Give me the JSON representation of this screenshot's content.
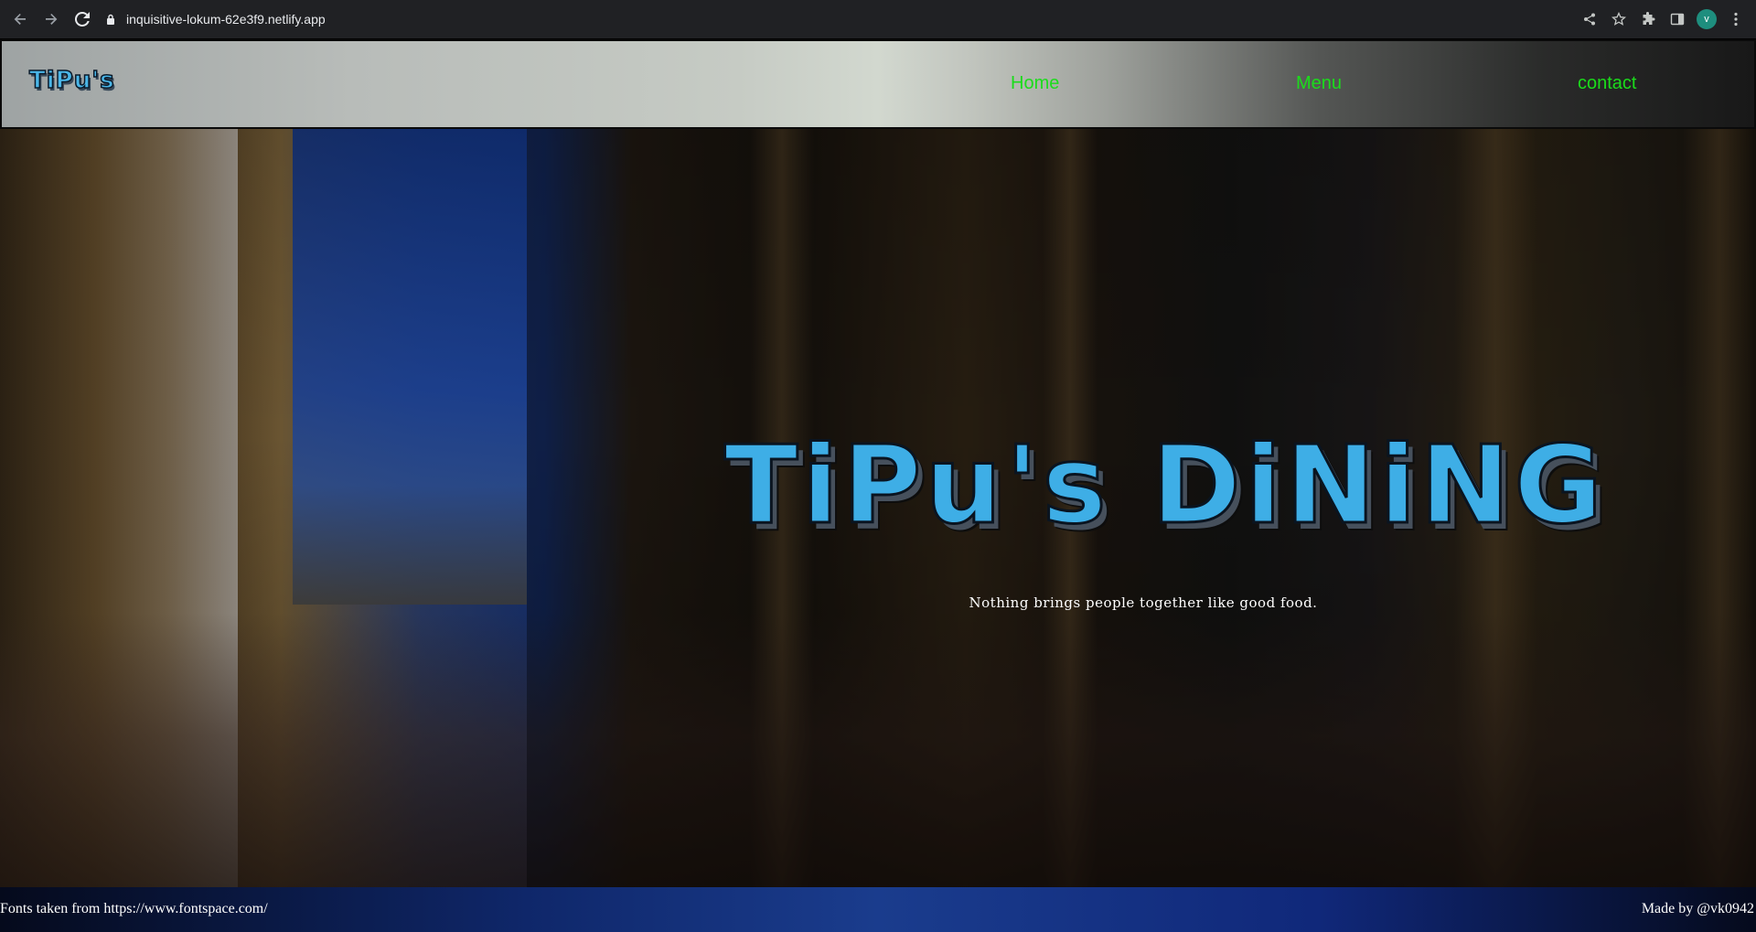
{
  "browser": {
    "url": "inquisitive-lokum-62e3f9.netlify.app",
    "profile_initial": "v",
    "icons": [
      "back-icon",
      "forward-icon",
      "reload-icon",
      "lock-icon",
      "share-icon",
      "star-icon",
      "extensions-icon",
      "side-panel-icon",
      "more-icon"
    ]
  },
  "header": {
    "logo_text": "TiPu's",
    "nav": [
      {
        "label": "Home"
      },
      {
        "label": "Menu"
      },
      {
        "label": "contact"
      }
    ],
    "nav_color": "#1bdc1b"
  },
  "hero": {
    "title": "TiPu's DiNiNG",
    "tagline": "Nothing brings people together like good food.",
    "title_color": "#3eaee6"
  },
  "footer": {
    "left_text": "Fonts taken from https://www.fontspace.com/",
    "right_text": "Made by @vk0942"
  }
}
